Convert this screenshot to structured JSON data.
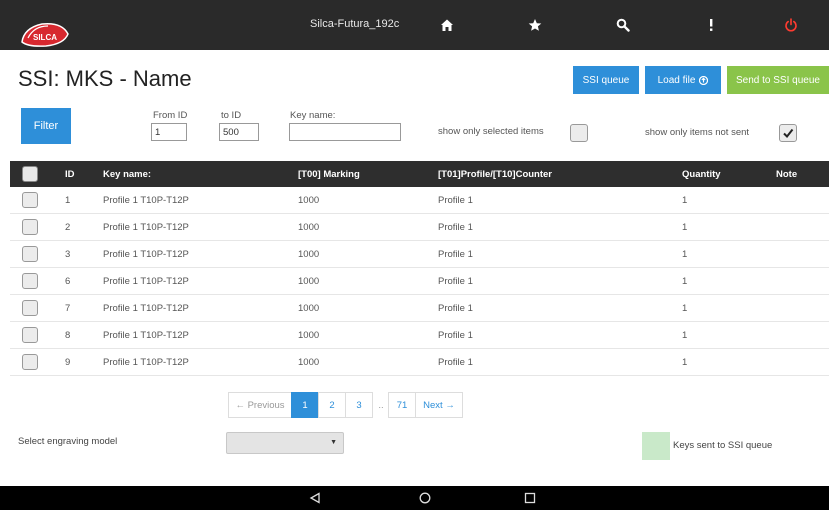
{
  "topbar": {
    "logo_text": "SILCA",
    "title": "Silca-Futura_192c",
    "icons": [
      "home-icon",
      "star-icon",
      "search-icon",
      "more-vertical-icon",
      "power-icon"
    ],
    "power_color": "#ff3b30"
  },
  "header": {
    "title": "SSI: MKS - Name",
    "ssi_queue_label": "SSI queue",
    "load_file_label": "Load file",
    "send_label": "Send to SSI queue"
  },
  "filter": {
    "button_label": "Filter",
    "from_id_label": "From ID",
    "from_id_value": "1",
    "to_id_label": "to ID",
    "to_id_value": "500",
    "key_name_label": "Key name:",
    "key_name_value": "",
    "show_selected_label": "show only selected items",
    "show_selected_checked": false,
    "show_not_sent_label": "show only items not sent",
    "show_not_sent_checked": true
  },
  "table": {
    "columns": [
      "ID",
      "Key name:",
      "[T00] Marking",
      "[T01]Profile/[T10]Counter",
      "Quantity",
      "Note"
    ],
    "rows": [
      {
        "id": "1",
        "key_name": "Profile 1 T10P-T12P",
        "marking": "1000",
        "profile": "Profile 1",
        "quantity": "1",
        "note": ""
      },
      {
        "id": "2",
        "key_name": "Profile 1 T10P-T12P",
        "marking": "1000",
        "profile": "Profile 1",
        "quantity": "1",
        "note": ""
      },
      {
        "id": "3",
        "key_name": "Profile 1 T10P-T12P",
        "marking": "1000",
        "profile": "Profile 1",
        "quantity": "1",
        "note": ""
      },
      {
        "id": "6",
        "key_name": "Profile 1 T10P-T12P",
        "marking": "1000",
        "profile": "Profile 1",
        "quantity": "1",
        "note": ""
      },
      {
        "id": "7",
        "key_name": "Profile 1 T10P-T12P",
        "marking": "1000",
        "profile": "Profile 1",
        "quantity": "1",
        "note": ""
      },
      {
        "id": "8",
        "key_name": "Profile 1 T10P-T12P",
        "marking": "1000",
        "profile": "Profile 1",
        "quantity": "1",
        "note": ""
      },
      {
        "id": "9",
        "key_name": "Profile 1 T10P-T12P",
        "marking": "1000",
        "profile": "Profile 1",
        "quantity": "1",
        "note": ""
      }
    ]
  },
  "pagination": {
    "previous": "← Previous",
    "pages": [
      "1",
      "2",
      "3"
    ],
    "ellipsis": "..",
    "last": "71",
    "next": "Next →",
    "current": "1"
  },
  "bottom": {
    "engraving_label": "Select engraving model",
    "engraving_value": "",
    "legend_label": "Keys sent to SSI queue",
    "legend_color": "#c9e9c9"
  },
  "colors": {
    "accent_blue": "#2e8fd9",
    "accent_green": "#8ac44a",
    "topbar": "#2a2a2a",
    "table_header": "#2e2e2e"
  }
}
